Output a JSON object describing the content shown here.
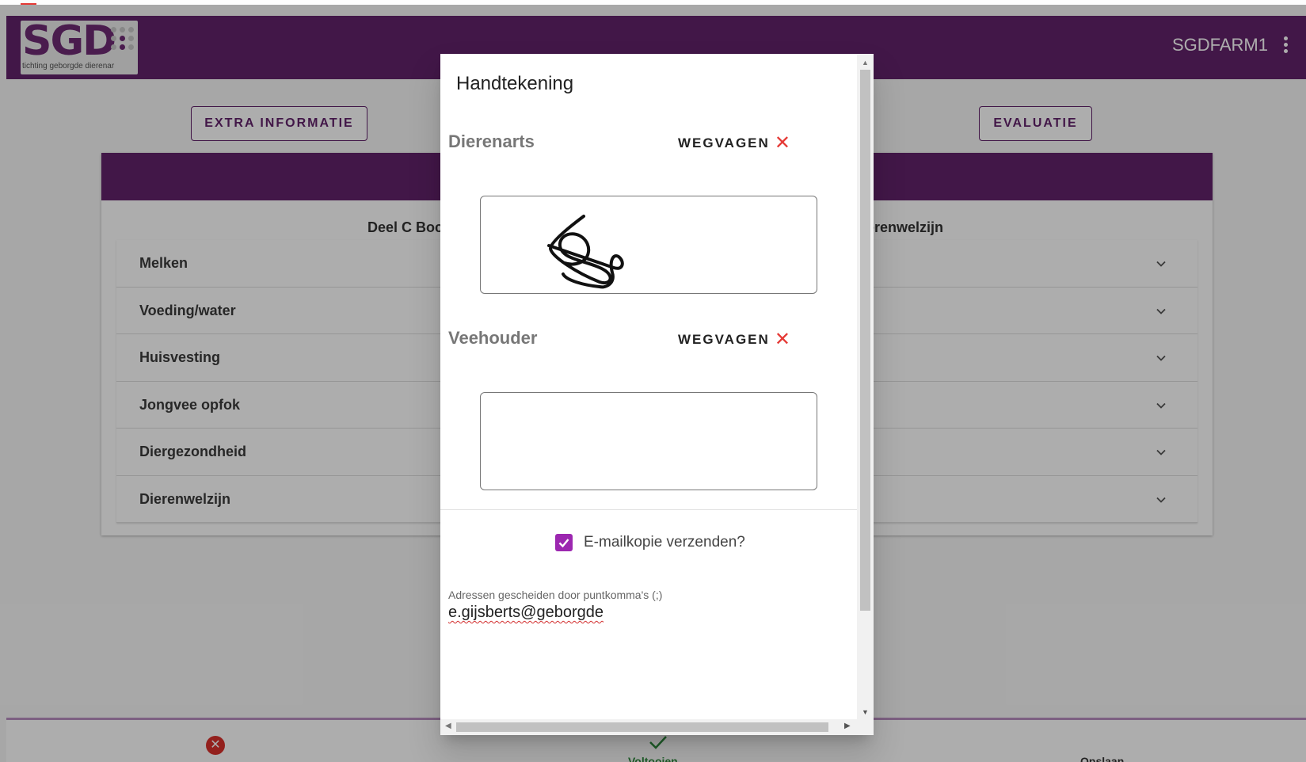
{
  "app": {
    "logo_text": "SGD",
    "logo_subtitle": "tichting geborgde dierenar",
    "user": "SGDFARM1"
  },
  "buttons": {
    "extra_info": "EXTRA INFORMATIE",
    "evaluatie": "EVALUATIE"
  },
  "card": {
    "subtitle_left": "Deel C Boc",
    "subtitle_right": "erenwelzijn",
    "sections": [
      {
        "label": "Melken"
      },
      {
        "label": "Voeding/water"
      },
      {
        "label": "Huisvesting"
      },
      {
        "label": "Jongvee opfok"
      },
      {
        "label": "Diergezondheid"
      },
      {
        "label": "Dierenwelzijn"
      }
    ]
  },
  "bottom_bar": {
    "complete_label": "Voltooien",
    "save_label": "Opslaan"
  },
  "dialog": {
    "title": "Handtekening",
    "vet_label": "Dierenarts",
    "farmer_label": "Veehouder",
    "clear_label": "WEGVAGEN",
    "email_copy_label": "E-mailkopie verzenden?",
    "email_copy_checked": true,
    "email_hint": "Adressen gescheiden door puntkomma's (;)",
    "email_value": "e.gijsberts@geborgde"
  },
  "colors": {
    "primary": "#62226b",
    "checkbox": "#9c27b0",
    "clear_icon": "#e53935",
    "cancel_icon": "#d9302b"
  }
}
